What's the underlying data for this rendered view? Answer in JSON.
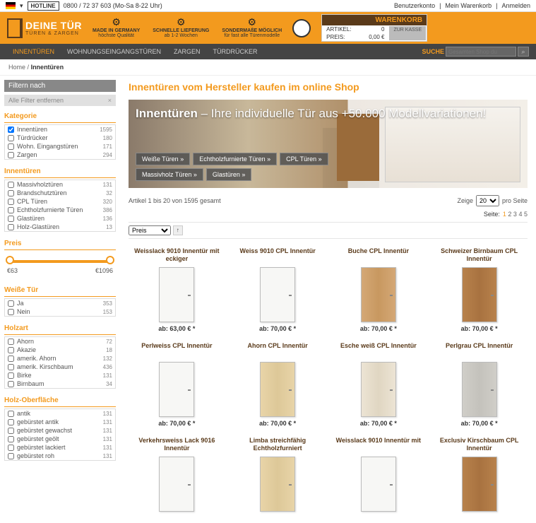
{
  "topbar": {
    "hotline": "HOTLINE",
    "phone": "0800 / 72 37 603 (Mo-Sa 8-22 Uhr)",
    "account": "Benutzerkonto",
    "cart": "Mein Warenkorb",
    "login": "Anmelden"
  },
  "logo": {
    "brand": "DEINE TÜR",
    "sub": "TÜREN & ZARGEN"
  },
  "features": [
    {
      "t1": "MADE IN GERMANY",
      "t2": "höchste Qualität"
    },
    {
      "t1": "SCHNELLE LIEFERUNG",
      "t2": "ab 1-2 Wochen"
    },
    {
      "t1": "SONDERMAßE MÖGLICH",
      "t2": "für fast alle Türenmodelle"
    }
  ],
  "cart": {
    "title": "WARENKORB",
    "line1": "ARTIKEL:",
    "val1": "0",
    "line2": "PREIS:",
    "val2": "0,00 €",
    "btn": "ZUR KASSE"
  },
  "nav": [
    "INNENTÜREN",
    "WOHNUNGSEINGANGSTÜREN",
    "ZARGEN",
    "TÜRDRÜCKER"
  ],
  "search": {
    "label": "SUCHE",
    "placeholder": "Gesamten Shop du"
  },
  "breadcrumb": {
    "home": "Home",
    "sep": "/",
    "current": "Innentüren"
  },
  "sidebar": {
    "head": "Filtern nach",
    "remove": "Alle Filter entfernen",
    "facets": [
      {
        "title": "Kategorie",
        "items": [
          {
            "label": "Innentüren",
            "cnt": "1595",
            "checked": true
          },
          {
            "label": "Türdrücker",
            "cnt": "180"
          },
          {
            "label": "Wohn. Eingangstüren",
            "cnt": "171"
          },
          {
            "label": "Zargen",
            "cnt": "294"
          }
        ]
      },
      {
        "title": "Innentüren",
        "items": [
          {
            "label": "Massivholztüren",
            "cnt": "131"
          },
          {
            "label": "Brandschutztüren",
            "cnt": "32"
          },
          {
            "label": "CPL Türen",
            "cnt": "320"
          },
          {
            "label": "Echtholzfurnierte Türen",
            "cnt": "386"
          },
          {
            "label": "Glastüren",
            "cnt": "136"
          },
          {
            "label": "Holz-Glastüren",
            "cnt": "13"
          }
        ]
      },
      {
        "title": "Preis",
        "slider": {
          "min": "€63",
          "max": "€1096"
        }
      },
      {
        "title": "Weiße Tür",
        "items": [
          {
            "label": "Ja",
            "cnt": "353"
          },
          {
            "label": "Nein",
            "cnt": "153"
          }
        ]
      },
      {
        "title": "Holzart",
        "items": [
          {
            "label": "Ahorn",
            "cnt": "72"
          },
          {
            "label": "Akazie",
            "cnt": "18"
          },
          {
            "label": "amerik. Ahorn",
            "cnt": "132"
          },
          {
            "label": "amerik. Kirschbaum",
            "cnt": "436"
          },
          {
            "label": "Birke",
            "cnt": "131"
          },
          {
            "label": "Birnbaum",
            "cnt": "34"
          }
        ]
      },
      {
        "title": "Holz-Oberfläche",
        "items": [
          {
            "label": "antik",
            "cnt": "131"
          },
          {
            "label": "gebürstet antik",
            "cnt": "131"
          },
          {
            "label": "gebürstet gewachst",
            "cnt": "131"
          },
          {
            "label": "gebürstet geölt",
            "cnt": "131"
          },
          {
            "label": "gebürstet lackiert",
            "cnt": "131"
          },
          {
            "label": "gebürstet roh",
            "cnt": "131"
          }
        ]
      }
    ]
  },
  "main": {
    "title": "Innentüren vom Hersteller kaufen im online Shop",
    "hero": {
      "head_bold": "Innentüren",
      "head_rest": " – Ihre individuelle Tür aus +50.000 Modellvariationen!",
      "btns": [
        "Weiße Türen »",
        "Echtholzfurnierte Türen »",
        "CPL Türen »",
        "Massivholz Türen »",
        "Glastüren »"
      ]
    },
    "count": "Artikel 1 bis 20 von 1595 gesamt",
    "show": {
      "label": "Zeige",
      "val": "20",
      "per": "pro Seite"
    },
    "pager": {
      "label": "Seite:",
      "pages": [
        "1",
        "2",
        "3",
        "4",
        "5"
      ]
    },
    "sort": {
      "val": "Preis"
    },
    "products": [
      {
        "name": "Weisslack 9010 Innentür mit eckiger",
        "cls": "white",
        "price": "ab: 63,00 € *"
      },
      {
        "name": "Weiss 9010 CPL Innentür",
        "cls": "white",
        "price": "ab: 70,00 € *"
      },
      {
        "name": "Buche CPL Innentür",
        "cls": "beech",
        "price": "ab: 70,00 € *"
      },
      {
        "name": "Schweizer Birnbaum CPL Innentür",
        "cls": "birnbaum",
        "price": "ab: 70,00 € *"
      },
      {
        "name": "Perlweiss CPL Innentür",
        "cls": "white",
        "price": "ab: 70,00 € *"
      },
      {
        "name": "Ahorn CPL Innentür",
        "cls": "ahorn",
        "price": "ab: 70,00 € *"
      },
      {
        "name": "Esche weiß CPL Innentür",
        "cls": "esche",
        "price": "ab: 70,00 € *"
      },
      {
        "name": "Perlgrau CPL Innentür",
        "cls": "grau",
        "price": "ab: 70,00 € *"
      },
      {
        "name": "Verkehrsweiss Lack 9016 Innentür",
        "cls": "white",
        "price": ""
      },
      {
        "name": "Limba streichfähig Echtholzfurniert",
        "cls": "ahorn",
        "price": ""
      },
      {
        "name": "Weisslack 9010 Innentür mit",
        "cls": "white",
        "price": ""
      },
      {
        "name": "Exclusiv Kirschbaum CPL Innentür",
        "cls": "birnbaum",
        "price": ""
      }
    ]
  }
}
